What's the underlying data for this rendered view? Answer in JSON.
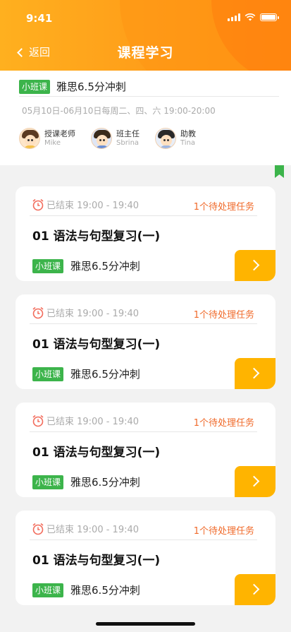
{
  "status_bar": {
    "time": "9:41"
  },
  "nav": {
    "back_label": "返回",
    "title": "课程学习"
  },
  "course_info": {
    "tag": "小班课",
    "course_name": "雅思6.5分冲刺",
    "schedule": "05月10日-06月10日每周二、四、六 19:00-20:00",
    "staff": [
      {
        "role": "授课老师",
        "name": "Mike"
      },
      {
        "role": "班主任",
        "name": "Sbrina"
      },
      {
        "role": "助教",
        "name": "Tina"
      }
    ]
  },
  "lessons": [
    {
      "status": "已结束 19:00 - 19:40",
      "pending": "1个待处理任务",
      "title": "01 语法与句型复习(一)",
      "tag": "小班课",
      "course": "雅思6.5分冲刺"
    },
    {
      "status": "已结束 19:00 - 19:40",
      "pending": "1个待处理任务",
      "title": "01 语法与句型复习(一)",
      "tag": "小班课",
      "course": "雅思6.5分冲刺"
    },
    {
      "status": "已结束 19:00 - 19:40",
      "pending": "1个待处理任务",
      "title": "01 语法与句型复习(一)",
      "tag": "小班课",
      "course": "雅思6.5分冲刺"
    },
    {
      "status": "已结束 19:00 - 19:40",
      "pending": "1个待处理任务",
      "title": "01 语法与句型复习(一)",
      "tag": "小班课",
      "course": "雅思6.5分冲刺"
    }
  ],
  "colors": {
    "accent_orange": "#ffa01a",
    "tag_green": "#3cb44b",
    "pending_orange": "#f06a2a",
    "button_yellow": "#ffb400"
  }
}
